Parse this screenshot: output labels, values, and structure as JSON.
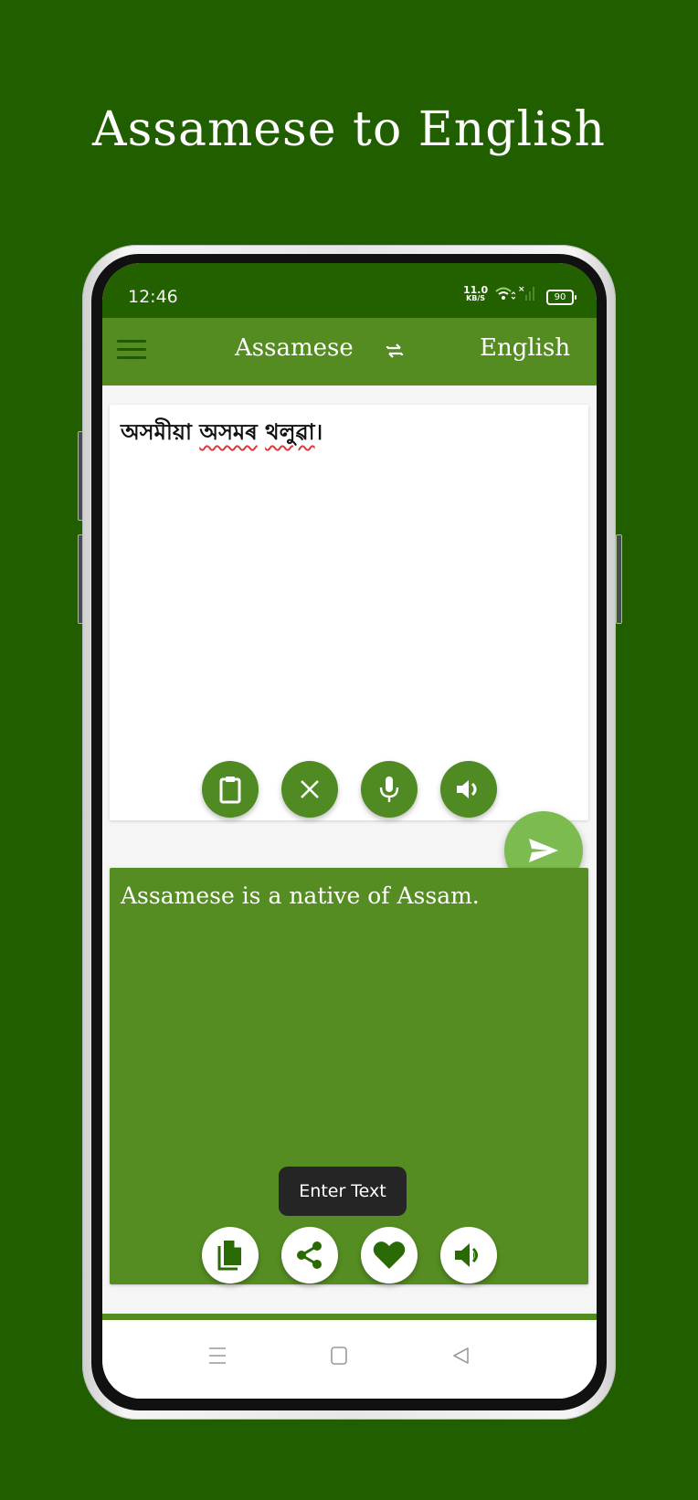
{
  "promo": {
    "headline": "Assamese to English"
  },
  "status_bar": {
    "time": "12:46",
    "net_speed": "11.0",
    "net_unit": "KB/S",
    "battery": "90",
    "icons": [
      "wifi-icon",
      "signal-no-sim-icon",
      "battery-icon"
    ]
  },
  "app_bar": {
    "menu_icon": "hamburger-menu-icon",
    "source_language": "Assamese",
    "swap_icon": "swap-arrows-icon",
    "target_language": "English"
  },
  "input": {
    "word1": "অসমীয়া",
    "word2": "অসমৰ",
    "word3": "থলুৱা",
    "punct": "।",
    "buttons": [
      {
        "name": "paste",
        "icon": "clipboard-icon"
      },
      {
        "name": "clear",
        "icon": "close-icon"
      },
      {
        "name": "voice",
        "icon": "microphone-icon"
      },
      {
        "name": "speak",
        "icon": "speaker-icon"
      }
    ]
  },
  "translate_button": {
    "icon": "send-icon"
  },
  "output": {
    "text": "Assamese is a native of Assam.",
    "buttons": [
      {
        "name": "copy",
        "icon": "copy-icon"
      },
      {
        "name": "share",
        "icon": "share-icon"
      },
      {
        "name": "favorite",
        "icon": "heart-icon"
      },
      {
        "name": "speak",
        "icon": "speaker-icon"
      }
    ]
  },
  "toast": {
    "text": "Enter Text"
  },
  "colors": {
    "background": "#215e00",
    "status_bar": "#236000",
    "app_bar": "#548c22",
    "accent_fab": "#7cbb4f",
    "icon_dark": "#1f5a00"
  }
}
